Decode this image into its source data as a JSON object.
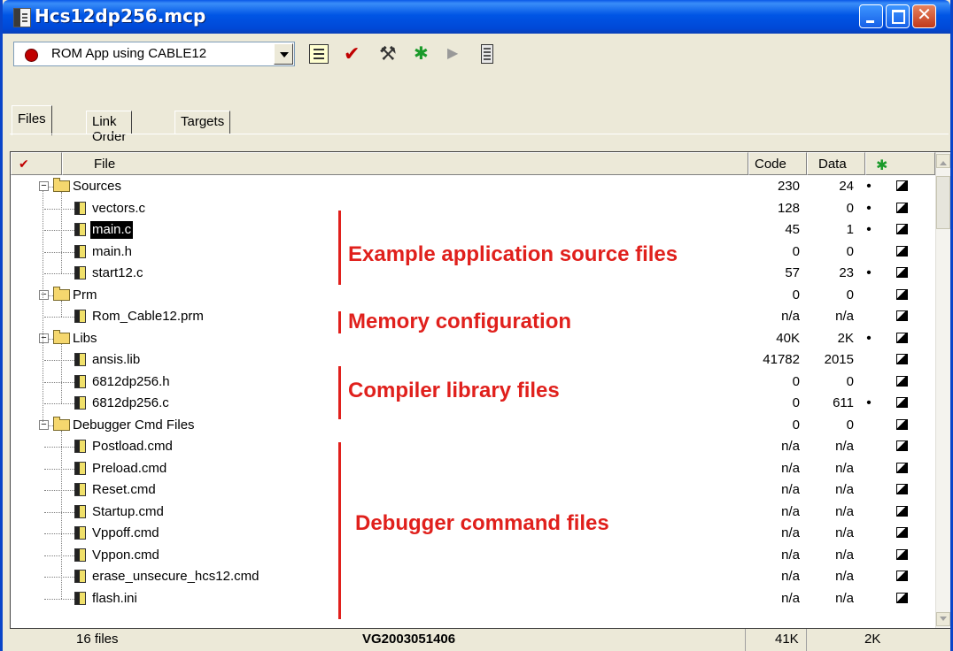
{
  "window": {
    "title": "Hcs12dp256.mcp",
    "minimize_label": "",
    "maximize_label": "",
    "close_label": "✕"
  },
  "toolbar": {
    "target": "ROM App using CABLE12"
  },
  "tabs": [
    "Files",
    "Link Order",
    "Targets"
  ],
  "columns": {
    "check": "✔",
    "file": "File",
    "code": "Code",
    "data": "Data",
    "debug": "✱"
  },
  "rows": [
    {
      "name": "Sources",
      "type": "group",
      "code": "230",
      "data": "24",
      "dot": "•"
    },
    {
      "name": "vectors.c",
      "type": "file",
      "code": "128",
      "data": "0",
      "dot": "•"
    },
    {
      "name": "main.c",
      "type": "file",
      "code": "45",
      "data": "1",
      "dot": "•",
      "selected": true
    },
    {
      "name": "main.h",
      "type": "file",
      "code": "0",
      "data": "0",
      "dot": ""
    },
    {
      "name": "start12.c",
      "type": "file",
      "code": "57",
      "data": "23",
      "dot": "•"
    },
    {
      "name": "Prm",
      "type": "group",
      "code": "0",
      "data": "0",
      "dot": ""
    },
    {
      "name": "Rom_Cable12.prm",
      "type": "file",
      "code": "n/a",
      "data": "n/a",
      "dot": ""
    },
    {
      "name": "Libs",
      "type": "group",
      "code": "40K",
      "data": "2K",
      "dot": "•"
    },
    {
      "name": "ansis.lib",
      "type": "file",
      "code": "41782",
      "data": "2015",
      "dot": ""
    },
    {
      "name": "6812dp256.h",
      "type": "file",
      "code": "0",
      "data": "0",
      "dot": ""
    },
    {
      "name": "6812dp256.c",
      "type": "file",
      "code": "0",
      "data": "611",
      "dot": "•"
    },
    {
      "name": "Debugger Cmd Files",
      "type": "group",
      "code": "0",
      "data": "0",
      "dot": ""
    },
    {
      "name": "Postload.cmd",
      "type": "file",
      "code": "n/a",
      "data": "n/a",
      "dot": ""
    },
    {
      "name": "Preload.cmd",
      "type": "file",
      "code": "n/a",
      "data": "n/a",
      "dot": ""
    },
    {
      "name": "Reset.cmd",
      "type": "file",
      "code": "n/a",
      "data": "n/a",
      "dot": ""
    },
    {
      "name": "Startup.cmd",
      "type": "file",
      "code": "n/a",
      "data": "n/a",
      "dot": ""
    },
    {
      "name": "Vppoff.cmd",
      "type": "file",
      "code": "n/a",
      "data": "n/a",
      "dot": ""
    },
    {
      "name": "Vppon.cmd",
      "type": "file",
      "code": "n/a",
      "data": "n/a",
      "dot": ""
    },
    {
      "name": "erase_unsecure_hcs12.cmd",
      "type": "file",
      "code": "n/a",
      "data": "n/a",
      "dot": ""
    },
    {
      "name": "flash.ini",
      "type": "file",
      "code": "n/a",
      "data": "n/a",
      "dot": ""
    }
  ],
  "annotations": [
    {
      "text": "Example application source files"
    },
    {
      "text": "Memory configuration"
    },
    {
      "text": "Compiler library files"
    },
    {
      "text": "Debugger command files"
    }
  ],
  "status": {
    "count": "16 files",
    "version": "VG2003051406",
    "code": "41K",
    "data": "2K"
  },
  "colors": {
    "annotation": "#e0201c",
    "titlebar": "#0055e5",
    "chrome": "#ece9d8"
  }
}
